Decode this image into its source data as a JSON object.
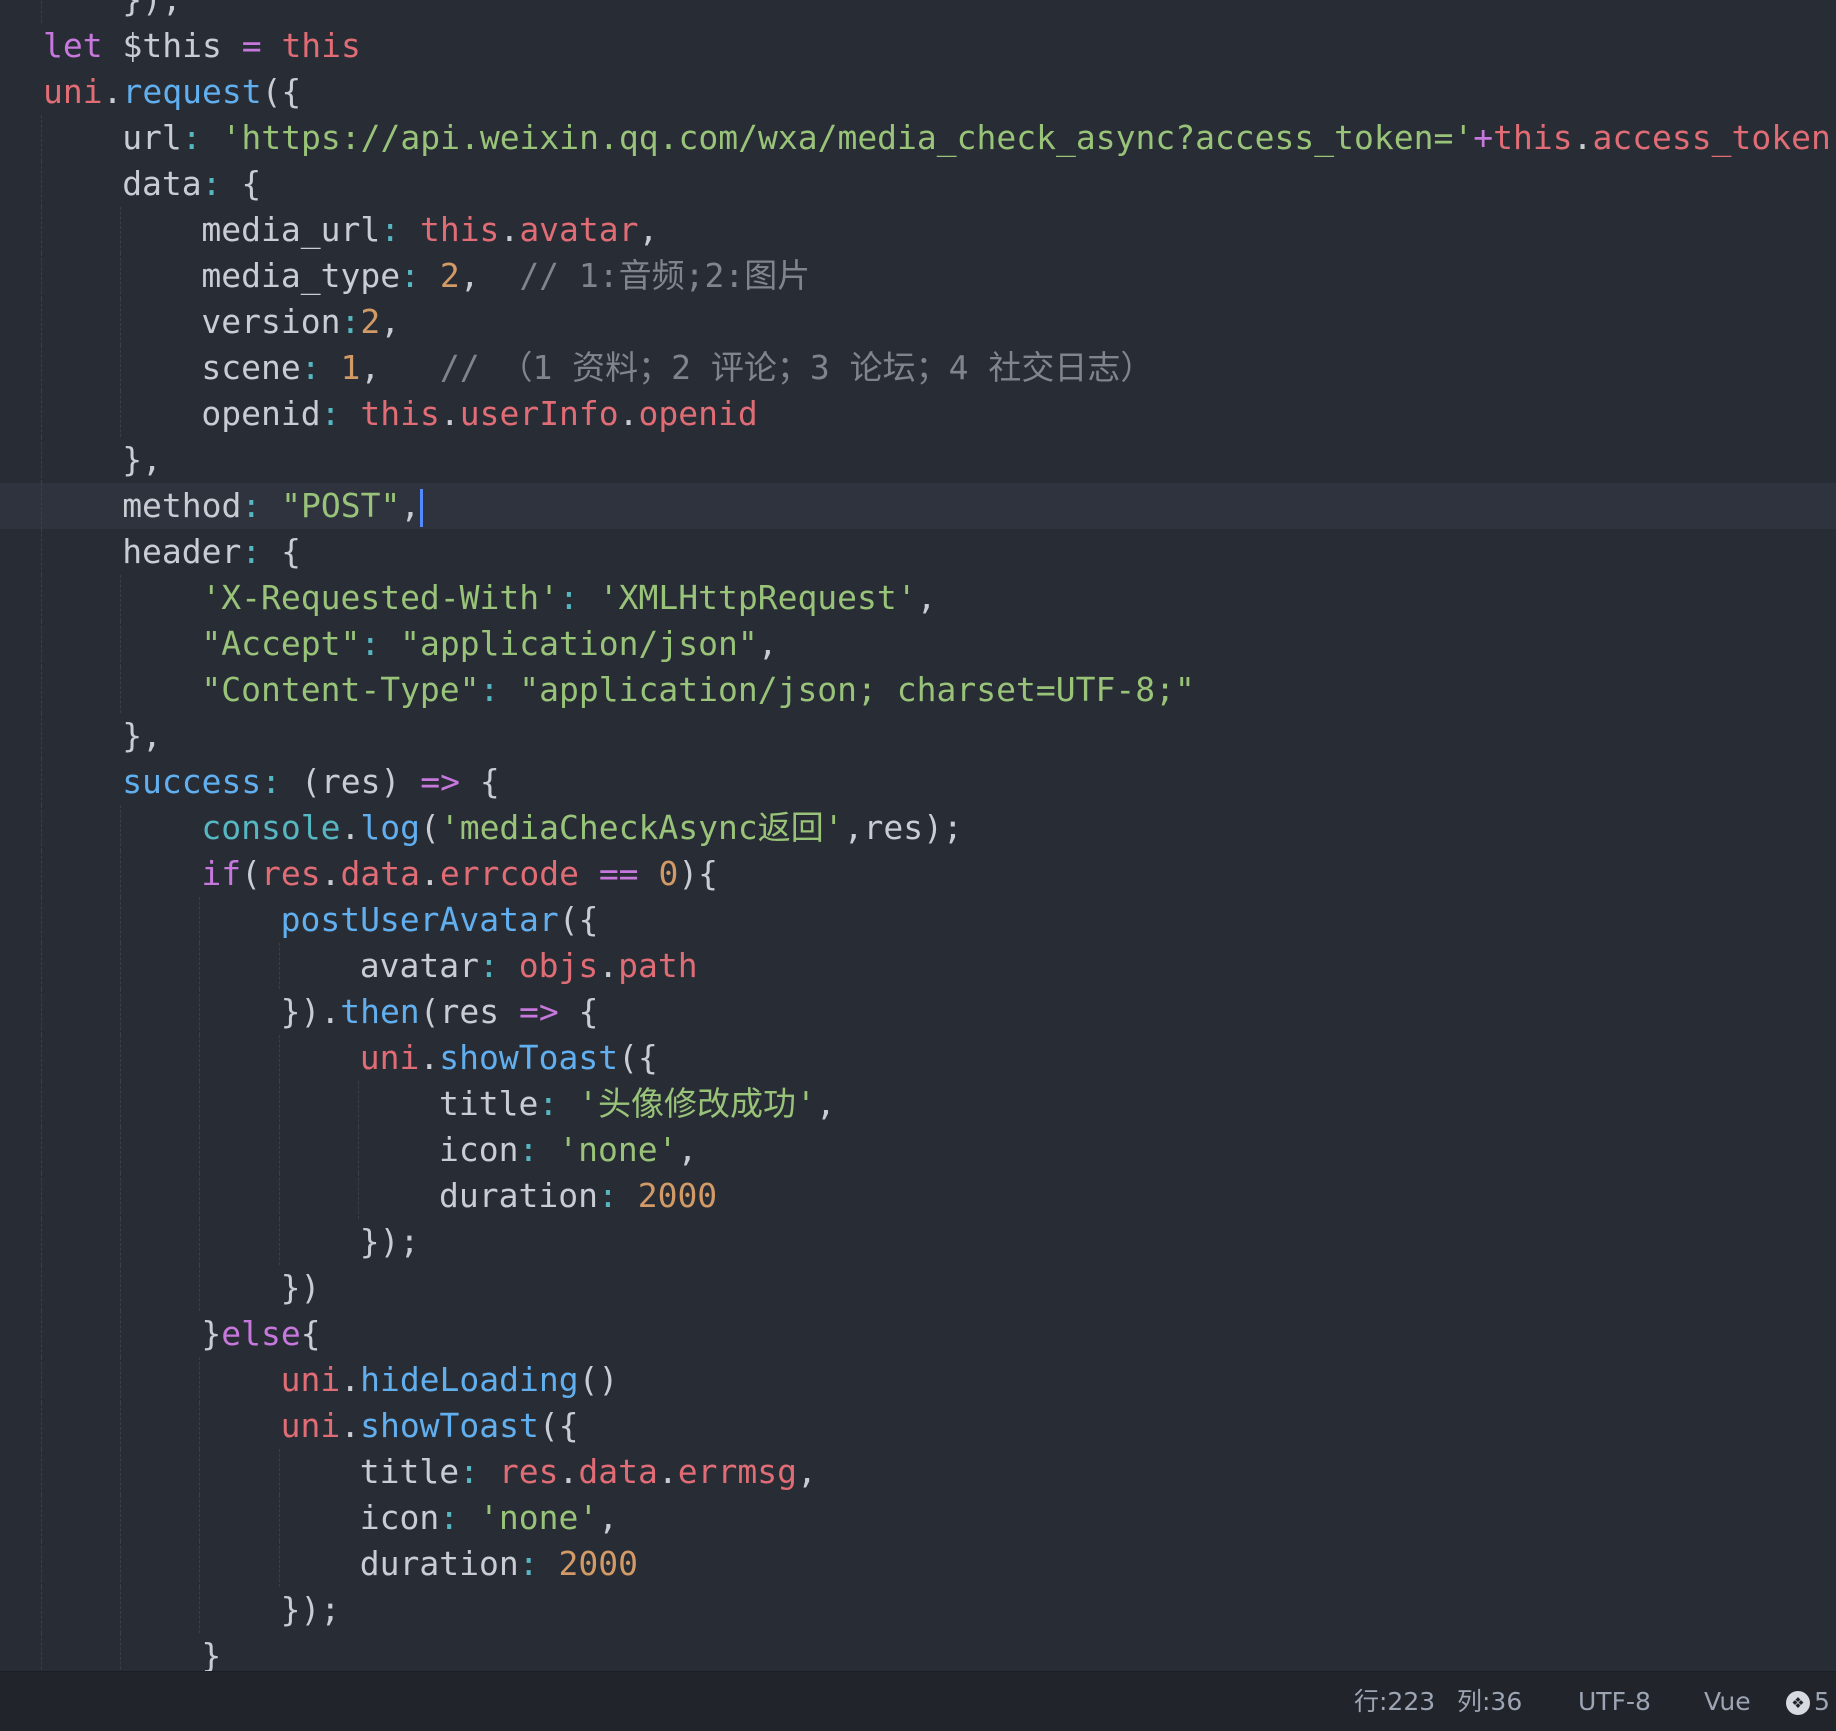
{
  "theme": {
    "background": "#282c34",
    "current_line": "#2e333e",
    "caret": "#528bff",
    "colors": {
      "kw": "#c678dd",
      "var": "#e06c75",
      "fn": "#61afef",
      "str": "#98c379",
      "num": "#d19a66",
      "punct": "#c9ccd3",
      "op": "#56b6c2",
      "cmt": "#7f848e",
      "console": "#56b6c2"
    }
  },
  "editor": {
    "lines": [
      [
        {
          "t": "});",
          "c": "punct"
        }
      ],
      [
        {
          "t": "let",
          "c": "kw"
        },
        {
          "t": " $this ",
          "c": "punct"
        },
        {
          "t": "=",
          "c": "kw"
        },
        {
          "t": " ",
          "c": "punct"
        },
        {
          "t": "this",
          "c": "var"
        }
      ],
      [
        {
          "t": "uni",
          "c": "var"
        },
        {
          "t": ".",
          "c": "punct"
        },
        {
          "t": "request",
          "c": "fn"
        },
        {
          "t": "({",
          "c": "punct"
        }
      ],
      [
        {
          "t": "url",
          "c": "punct"
        },
        {
          "t": ": ",
          "c": "op"
        },
        {
          "t": "'https://api.weixin.qq.com/wxa/media_check_async?access_token='",
          "c": "str"
        },
        {
          "t": "+",
          "c": "kw"
        },
        {
          "t": "this",
          "c": "var"
        },
        {
          "t": ".",
          "c": "punct"
        },
        {
          "t": "access_token",
          "c": "var"
        },
        {
          "t": ",",
          "c": "punct"
        }
      ],
      [
        {
          "t": "data",
          "c": "punct"
        },
        {
          "t": ": ",
          "c": "op"
        },
        {
          "t": "{",
          "c": "punct"
        }
      ],
      [
        {
          "t": "media_url",
          "c": "punct"
        },
        {
          "t": ": ",
          "c": "op"
        },
        {
          "t": "this",
          "c": "var"
        },
        {
          "t": ".",
          "c": "punct"
        },
        {
          "t": "avatar",
          "c": "var"
        },
        {
          "t": ",",
          "c": "punct"
        }
      ],
      [
        {
          "t": "media_type",
          "c": "punct"
        },
        {
          "t": ": ",
          "c": "op"
        },
        {
          "t": "2",
          "c": "num"
        },
        {
          "t": ",  ",
          "c": "punct"
        },
        {
          "t": "// 1:音频;2:图片",
          "c": "cmt"
        }
      ],
      [
        {
          "t": "version",
          "c": "punct"
        },
        {
          "t": ":",
          "c": "op"
        },
        {
          "t": "2",
          "c": "num"
        },
        {
          "t": ",",
          "c": "punct"
        }
      ],
      [
        {
          "t": "scene",
          "c": "punct"
        },
        {
          "t": ": ",
          "c": "op"
        },
        {
          "t": "1",
          "c": "num"
        },
        {
          "t": ",   ",
          "c": "punct"
        },
        {
          "t": "// （1 资料；2 评论；3 论坛；4 社交日志）",
          "c": "cmt"
        }
      ],
      [
        {
          "t": "openid",
          "c": "punct"
        },
        {
          "t": ": ",
          "c": "op"
        },
        {
          "t": "this",
          "c": "var"
        },
        {
          "t": ".",
          "c": "punct"
        },
        {
          "t": "userInfo",
          "c": "var"
        },
        {
          "t": ".",
          "c": "punct"
        },
        {
          "t": "openid",
          "c": "var"
        }
      ],
      [
        {
          "t": "},",
          "c": "punct"
        }
      ],
      [
        {
          "t": "method",
          "c": "punct"
        },
        {
          "t": ": ",
          "c": "op"
        },
        {
          "t": "\"POST\"",
          "c": "str"
        },
        {
          "t": ",",
          "c": "punct"
        }
      ],
      [
        {
          "t": "header",
          "c": "punct"
        },
        {
          "t": ": ",
          "c": "op"
        },
        {
          "t": "{",
          "c": "punct"
        }
      ],
      [
        {
          "t": "'X-Requested-With'",
          "c": "str"
        },
        {
          "t": ": ",
          "c": "op"
        },
        {
          "t": "'XMLHttpRequest'",
          "c": "str"
        },
        {
          "t": ",",
          "c": "punct"
        }
      ],
      [
        {
          "t": "\"Accept\"",
          "c": "str"
        },
        {
          "t": ": ",
          "c": "op"
        },
        {
          "t": "\"application/json\"",
          "c": "str"
        },
        {
          "t": ",",
          "c": "punct"
        }
      ],
      [
        {
          "t": "\"Content-Type\"",
          "c": "str"
        },
        {
          "t": ": ",
          "c": "op"
        },
        {
          "t": "\"application/json; charset=UTF-8;\"",
          "c": "str"
        }
      ],
      [
        {
          "t": "},",
          "c": "punct"
        }
      ],
      [
        {
          "t": "success",
          "c": "fn"
        },
        {
          "t": ": ",
          "c": "op"
        },
        {
          "t": "(res) ",
          "c": "punct"
        },
        {
          "t": "=>",
          "c": "kw"
        },
        {
          "t": " {",
          "c": "punct"
        }
      ],
      [
        {
          "t": "console",
          "c": "console"
        },
        {
          "t": ".",
          "c": "punct"
        },
        {
          "t": "log",
          "c": "fn"
        },
        {
          "t": "(",
          "c": "punct"
        },
        {
          "t": "'mediaCheckAsync返回'",
          "c": "str"
        },
        {
          "t": ",res);",
          "c": "punct"
        }
      ],
      [
        {
          "t": "if",
          "c": "kw"
        },
        {
          "t": "(",
          "c": "punct"
        },
        {
          "t": "res",
          "c": "var"
        },
        {
          "t": ".",
          "c": "punct"
        },
        {
          "t": "data",
          "c": "var"
        },
        {
          "t": ".",
          "c": "punct"
        },
        {
          "t": "errcode",
          "c": "var"
        },
        {
          "t": " ",
          "c": "punct"
        },
        {
          "t": "==",
          "c": "kw"
        },
        {
          "t": " ",
          "c": "punct"
        },
        {
          "t": "0",
          "c": "num"
        },
        {
          "t": "){",
          "c": "punct"
        }
      ],
      [
        {
          "t": "postUserAvatar",
          "c": "fn"
        },
        {
          "t": "({",
          "c": "punct"
        }
      ],
      [
        {
          "t": "avatar",
          "c": "punct"
        },
        {
          "t": ": ",
          "c": "op"
        },
        {
          "t": "objs",
          "c": "var"
        },
        {
          "t": ".",
          "c": "punct"
        },
        {
          "t": "path",
          "c": "var"
        }
      ],
      [
        {
          "t": "}).",
          "c": "punct"
        },
        {
          "t": "then",
          "c": "fn"
        },
        {
          "t": "(res ",
          "c": "punct"
        },
        {
          "t": "=>",
          "c": "kw"
        },
        {
          "t": " {",
          "c": "punct"
        }
      ],
      [
        {
          "t": "uni",
          "c": "var"
        },
        {
          "t": ".",
          "c": "punct"
        },
        {
          "t": "showToast",
          "c": "fn"
        },
        {
          "t": "({",
          "c": "punct"
        }
      ],
      [
        {
          "t": "title",
          "c": "punct"
        },
        {
          "t": ": ",
          "c": "op"
        },
        {
          "t": "'头像修改成功'",
          "c": "str"
        },
        {
          "t": ",",
          "c": "punct"
        }
      ],
      [
        {
          "t": "icon",
          "c": "punct"
        },
        {
          "t": ": ",
          "c": "op"
        },
        {
          "t": "'none'",
          "c": "str"
        },
        {
          "t": ",",
          "c": "punct"
        }
      ],
      [
        {
          "t": "duration",
          "c": "punct"
        },
        {
          "t": ": ",
          "c": "op"
        },
        {
          "t": "2000",
          "c": "num"
        }
      ],
      [
        {
          "t": "});",
          "c": "punct"
        }
      ],
      [
        {
          "t": "})",
          "c": "punct"
        }
      ],
      [
        {
          "t": "}",
          "c": "punct"
        },
        {
          "t": "else",
          "c": "kw"
        },
        {
          "t": "{",
          "c": "punct"
        }
      ],
      [
        {
          "t": "uni",
          "c": "var"
        },
        {
          "t": ".",
          "c": "punct"
        },
        {
          "t": "hideLoading",
          "c": "fn"
        },
        {
          "t": "()",
          "c": "punct"
        }
      ],
      [
        {
          "t": "uni",
          "c": "var"
        },
        {
          "t": ".",
          "c": "punct"
        },
        {
          "t": "showToast",
          "c": "fn"
        },
        {
          "t": "({",
          "c": "punct"
        }
      ],
      [
        {
          "t": "title",
          "c": "punct"
        },
        {
          "t": ": ",
          "c": "op"
        },
        {
          "t": "res",
          "c": "var"
        },
        {
          "t": ".",
          "c": "punct"
        },
        {
          "t": "data",
          "c": "var"
        },
        {
          "t": ".",
          "c": "punct"
        },
        {
          "t": "errmsg",
          "c": "var"
        },
        {
          "t": ",",
          "c": "punct"
        }
      ],
      [
        {
          "t": "icon",
          "c": "punct"
        },
        {
          "t": ": ",
          "c": "op"
        },
        {
          "t": "'none'",
          "c": "str"
        },
        {
          "t": ",",
          "c": "punct"
        }
      ],
      [
        {
          "t": "duration",
          "c": "punct"
        },
        {
          "t": ": ",
          "c": "op"
        },
        {
          "t": "2000",
          "c": "num"
        }
      ],
      [
        {
          "t": "});",
          "c": "punct"
        }
      ],
      [
        {
          "t": "}",
          "c": "punct"
        }
      ]
    ]
  },
  "statusbar": {
    "line": "行:223",
    "column": "列:36",
    "encoding": "UTF-8",
    "language": "Vue",
    "notification_count": "5",
    "notification_icon": "chat-bubble-icon"
  }
}
